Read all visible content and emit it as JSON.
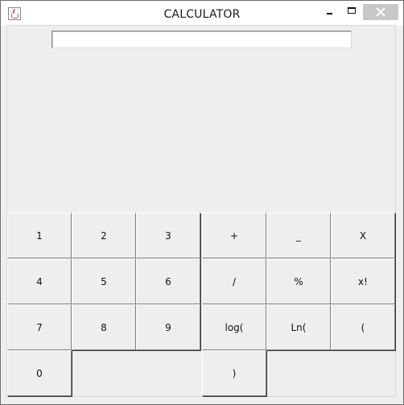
{
  "window": {
    "title": "CALCULATOR"
  },
  "display": {
    "value": ""
  },
  "keys": {
    "k1": "1",
    "k2": "2",
    "k3": "3",
    "plus": "+",
    "minus": "_",
    "multiply": "X",
    "k4": "4",
    "k5": "5",
    "k6": "6",
    "divide": "/",
    "percent": "%",
    "factorial": "x!",
    "k7": "7",
    "k8": "8",
    "k9": "9",
    "log": "log(",
    "ln": "Ln(",
    "open_paren": "(",
    "k0": "0",
    "close_paren": ")"
  }
}
